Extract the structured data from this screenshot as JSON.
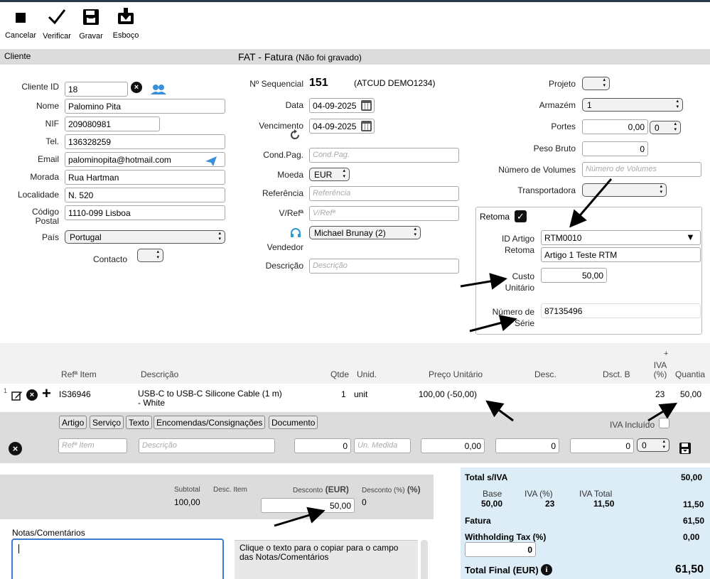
{
  "toolbar": {
    "cancel": "Cancelar",
    "verify": "Verificar",
    "save": "Gravar",
    "draft": "Esboço"
  },
  "section": {
    "client": "Cliente",
    "title": "FAT - Fatura",
    "title_note": "(Não foi gravado)"
  },
  "client": {
    "id_label": "Cliente ID",
    "id_value": "18",
    "name_label": "Nome",
    "name_value": "Palomino Pita",
    "nif_label": "NIF",
    "nif_value": "209080981",
    "tel_label": "Tel.",
    "tel_value": "136328259",
    "email_label": "Email",
    "email_value": "palominopita@hotmail.com",
    "address_label": "Morada",
    "address_value": "Rua Hartman",
    "locality_label": "Localidade",
    "locality_value": "N. 520",
    "postal_label": "Código Postal",
    "postal_value": "1110-099 Lisboa",
    "country_label": "País",
    "country_value": "Portugal",
    "contact_label": "Contacto"
  },
  "doc": {
    "seq_label": "Nº Sequencial",
    "seq_value": "151",
    "atcud": "(ATCUD DEMO1234)",
    "date_label": "Data",
    "date_value": "04-09-2025",
    "due_label": "Vencimento",
    "due_value": "04-09-2025",
    "payterms_label": "Cond.Pag.",
    "payterms_placeholder": "Cond.Pag.",
    "currency_label": "Moeda",
    "currency_value": "EUR",
    "reference_label": "Referência",
    "reference_placeholder": "Referência",
    "vref_label": "V/Refª",
    "vref_placeholder": "V/Refª",
    "seller_label": "Vendedor",
    "seller_value": "Michael Brunay (2)",
    "description_label": "Descrição",
    "description_placeholder": "Descrição"
  },
  "right": {
    "project_label": "Projeto",
    "warehouse_label": "Armazém",
    "warehouse_value": "1",
    "shipping_label": "Portes",
    "shipping_value": "0,00",
    "shipping_vat": "0",
    "weight_label": "Peso Bruto",
    "weight_value": "0",
    "volumes_label": "Número de Volumes",
    "volumes_placeholder": "Número de Volumes",
    "carrier_label": "Transportadora"
  },
  "retoma": {
    "label": "Retoma",
    "article_label": "ID Artigo Retoma",
    "article_value": "RTM0010",
    "article_desc": "Artigo 1 Teste RTM",
    "cost_label": "Custo Unitário",
    "cost_value": "50,00",
    "serial_label": "Número de Série",
    "serial_value": "87135496"
  },
  "table": {
    "headers": {
      "ref": "Refª Item",
      "desc": "Descrição",
      "qty": "Qtde",
      "unit": "Unid.",
      "price": "Preço Unitário",
      "disc": "Desc.",
      "discb": "Dsct. B",
      "vat_plus": "+",
      "vat": "IVA (%)",
      "total": "Quantia"
    },
    "row": {
      "index": "1",
      "ref": "IS36946",
      "desc": "USB-C to USB-C Silicone Cable (1 m) - White",
      "qty": "1",
      "unit": "unit",
      "price": "100,00 (-50,00)",
      "vat": "23",
      "total": "50,00"
    },
    "type_buttons": [
      "Artigo",
      "Serviço",
      "Texto",
      "Encomendas/Consignações",
      "Documento"
    ],
    "vat_included": "IVA Incluído",
    "new_row": {
      "ref_placeholder": "Refª Item",
      "desc_placeholder": "Descrição",
      "qty": "0",
      "unit_placeholder": "Un. Medida",
      "price": "0,00",
      "disc": "0",
      "discb": "0",
      "vat": "0"
    }
  },
  "summary": {
    "subtotal_label": "Subtotal",
    "subtotal_value": "100,00",
    "desc_item_label": "Desc. Item",
    "discount_label": "Desconto",
    "discount_currency": "(EUR)",
    "discount_value": "50,00",
    "discount_pct_label": "Desconto (%)",
    "discount_pct_paren": "(%)",
    "discount_pct_value": "0"
  },
  "notes": {
    "label": "Notas/Comentários",
    "hint": "Clique o texto para o copiar para o campo das Notas/Comentários"
  },
  "totals": {
    "total_net_label": "Total s/IVA",
    "total_net_value": "50,00",
    "base_label": "Base",
    "base_value": "50,00",
    "vat_pct_label": "IVA (%)",
    "vat_pct_value": "23",
    "vat_total_label": "IVA Total",
    "vat_total_value": "11,50",
    "vat_total_right": "11,50",
    "invoice_label": "Fatura",
    "invoice_value": "61,50",
    "withholding_label": "Withholding Tax (%)",
    "withholding_value": "0,00",
    "withholding_input": "0",
    "final_label": "Total Final (EUR)",
    "final_value": "61,50"
  },
  "colors": {
    "header_gray": "#dcdcdc",
    "totals_blue": "#dcedf8",
    "button_gray": "#e6e6e6"
  }
}
